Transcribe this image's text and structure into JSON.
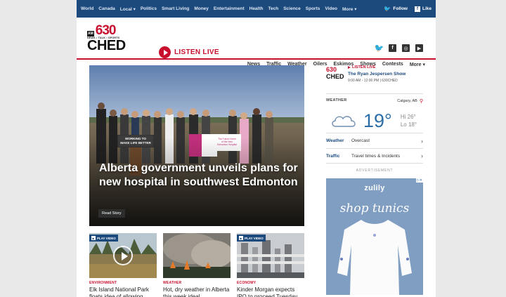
{
  "topnav": {
    "links": [
      "World",
      "Canada",
      "Local ▾",
      "Politics",
      "Smart Living",
      "Money",
      "Entertainment",
      "Health",
      "Tech",
      "Science",
      "Sports",
      "Video",
      "More ▾"
    ],
    "follow_label": "Follow",
    "like_label": "Like",
    "twitter_icon": "twitter-icon",
    "facebook_icon": "facebook-icon"
  },
  "header": {
    "logo": {
      "am": "AM",
      "number": "630",
      "tagline": "NEWS • TALK • SPORTS",
      "name": "CHED"
    },
    "listen_live_label": "LISTEN LIVE",
    "social_icons": [
      "twitter-icon",
      "facebook-icon",
      "instagram-icon",
      "youtube-icon"
    ],
    "nav": [
      "News",
      "Traffic",
      "Weather",
      "Oilers",
      "Eskimos",
      "Shows",
      "Contests",
      "More ▾"
    ]
  },
  "hero": {
    "headline": "Alberta government unveils plans for new hospital in southwest Edmonton",
    "read_story_label": "Read Story",
    "sign_text": "WORKING TO MAKE LIFE BETTER",
    "banner_text": "The Future Home of the New Edmonton Hospital"
  },
  "cards": [
    {
      "badge": "PLAY VIDEO",
      "category": "ENVIRONMENT",
      "title": "Elk Island National Park floats idea of allowing"
    },
    {
      "badge": "",
      "category": "WEATHER",
      "title": "Hot, dry weather in Alberta this week ideal"
    },
    {
      "badge": "PLAY VIDEO",
      "category": "ECONOMY",
      "title": "Kinder Morgan expects IPO to proceed Tuesday"
    }
  ],
  "sidebar": {
    "mini_logo": {
      "number": "630",
      "name": "CHED"
    },
    "listen_live": "LISTEN LIVE",
    "show_name": "The Ryan Jespersen Show",
    "show_time": "9:00 AM - 12:00 PM | 630CHED",
    "weather": {
      "label": "WEATHER",
      "location": "Calgary, AB",
      "temp": "19°",
      "hi": "Hi 26°",
      "lo": "Lo 18°",
      "icon": "cloud-icon",
      "rows": [
        {
          "key": "Weather",
          "value": "Overcast"
        },
        {
          "key": "Traffic",
          "value": "Travel times & Incidents"
        }
      ]
    },
    "ad_label": "ADVERTISEMENT",
    "ad": {
      "brand": "zulily",
      "headline": "shop tunics",
      "choices": "▷✕"
    }
  },
  "colors": {
    "brand_blue": "#1c4a7d",
    "brand_red": "#c8102e",
    "temp_blue": "#2b6ea8"
  }
}
